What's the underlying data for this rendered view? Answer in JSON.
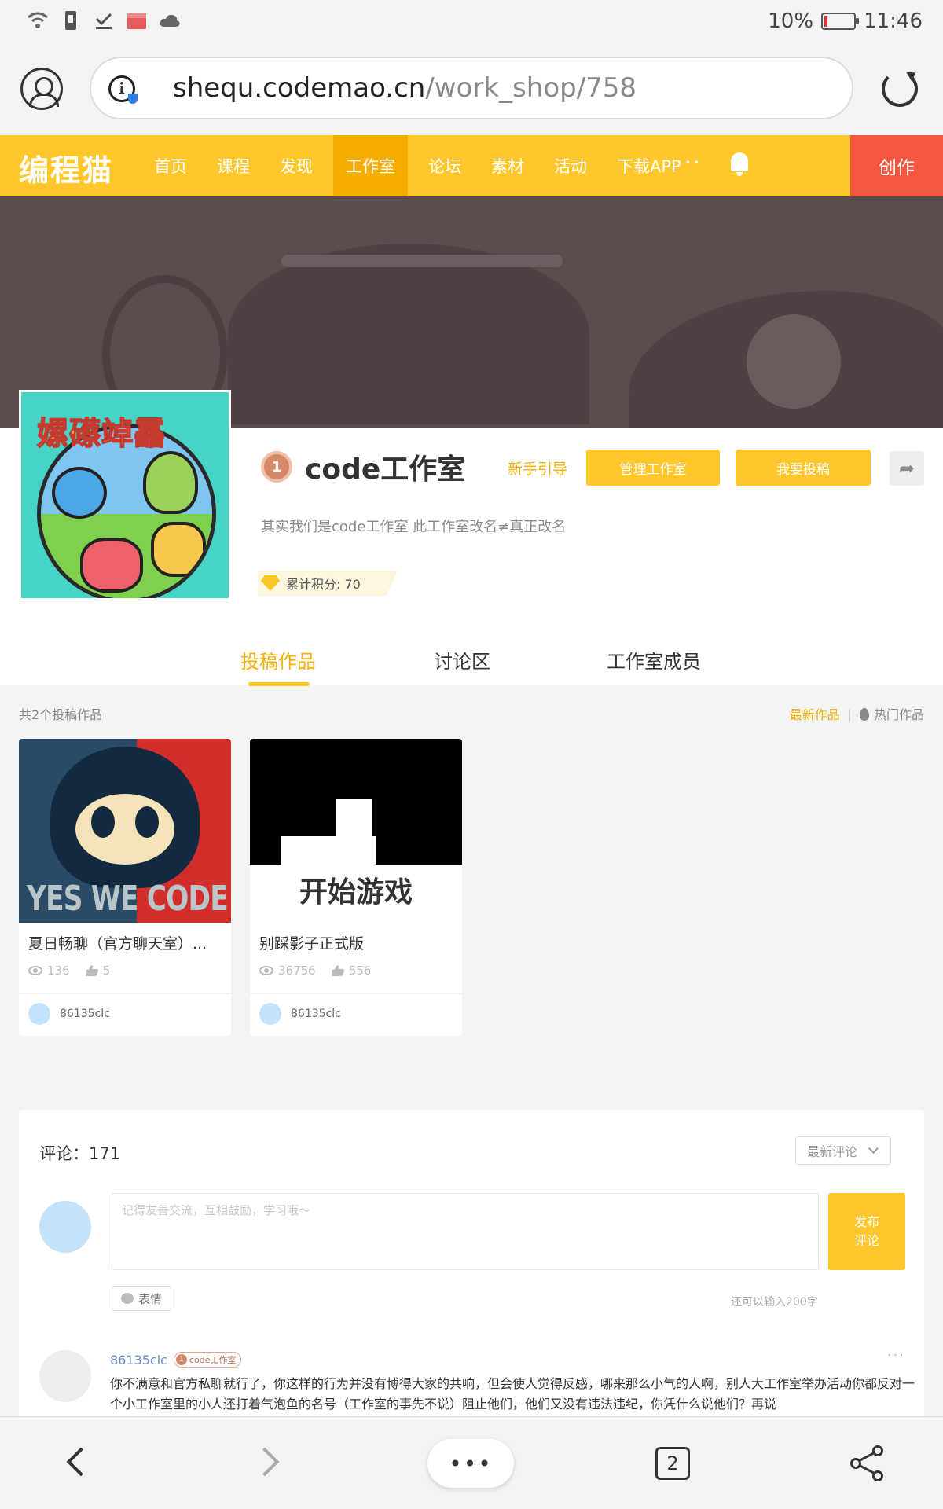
{
  "status": {
    "battery": "10%",
    "time": "11:46"
  },
  "browser": {
    "url_host": "shequ.codemao.cn",
    "url_path": "/work_shop/758",
    "tab_count": "2"
  },
  "nav": {
    "logo": "编程猫",
    "items": [
      "首页",
      "课程",
      "发现",
      "工作室",
      "论坛",
      "素材",
      "活动",
      "下载APP"
    ],
    "more": "···",
    "create": "创作"
  },
  "profile": {
    "avatar_title": "嫘礤竨靐",
    "level": "1",
    "name": "code工作室",
    "guide": "新手引导",
    "manage": "管理工作室",
    "submit": "我要投稿",
    "description": "其实我们是code工作室 此工作室改名≠真正改名",
    "points": "累计积分: 70"
  },
  "tabs": [
    "投稿作品",
    "讨论区",
    "工作室成员"
  ],
  "works": {
    "count_label": "共2个投稿作品",
    "sort_new": "最新作品",
    "sort_sep": "|",
    "sort_hot": "热门作品",
    "items": [
      {
        "title": "夏日畅聊（官方聊天室）...",
        "views": "136",
        "likes": "5",
        "author": "86135clc",
        "thumb_text": "YES WE CODE"
      },
      {
        "title": "别踩影子正式版",
        "views": "36756",
        "likes": "556",
        "author": "86135clc",
        "thumb_text": "开始游戏"
      }
    ]
  },
  "comments": {
    "count": "评论：171",
    "sort": "最新评论",
    "placeholder": "记得友善交流，互相鼓励，学习哦～",
    "publish": "发布\n评论",
    "emoji": "表情",
    "char_left": "还可以输入200字",
    "first": {
      "author": "86135clc",
      "tag_level": "1",
      "tag": "code工作室",
      "more": "···",
      "text": "你不满意和官方私聊就行了，你这样的行为并没有博得大家的共响，但会使人觉得反感，哪来那么小气的人啊，别人大工作室举办活动你都反对一个小工作室里的小人还打着气泡鱼的名号（工作室的事先不说）阻止他们，他们又没有违法违纪，你凭什么说他们？再说"
    }
  }
}
